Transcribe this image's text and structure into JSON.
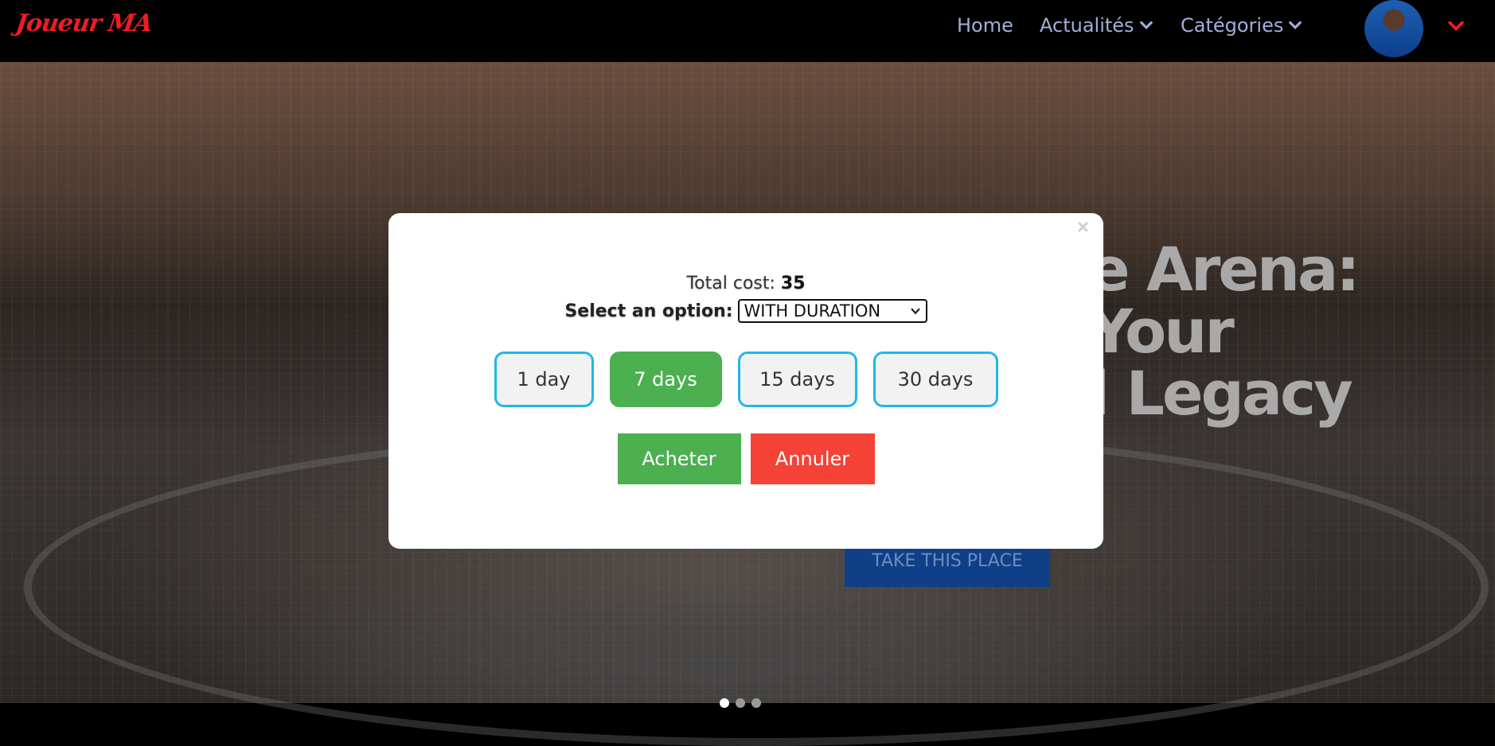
{
  "navbar": {
    "logo": "Joueur MA",
    "links": [
      {
        "label": "Home"
      },
      {
        "label": "Actualités"
      },
      {
        "label": "Catégories"
      }
    ]
  },
  "hero": {
    "title_lines": [
      "e Arena:",
      "Your",
      "l Legacy"
    ],
    "cta_label": "TAKE THIS PLACE",
    "slide_count": 3,
    "active_slide": 1
  },
  "modal": {
    "close_glyph": "×",
    "total_label": "Total cost:",
    "total_value": "35",
    "select_label": "Select an option:",
    "select_value": "WITH DURATION",
    "durations": [
      {
        "label": "1 day",
        "active": false
      },
      {
        "label": "7 days",
        "active": true
      },
      {
        "label": "15 days",
        "active": false
      },
      {
        "label": "30 days",
        "active": false
      }
    ],
    "buy_label": "Acheter",
    "cancel_label": "Annuler"
  },
  "colors": {
    "logo": "#ee1c25",
    "nav_link": "#9fb0d8",
    "active_duration": "#4caf50",
    "duration_border": "#1fb8e8",
    "buy": "#4caf50",
    "cancel": "#f44336",
    "cta": "#0f3f87"
  }
}
